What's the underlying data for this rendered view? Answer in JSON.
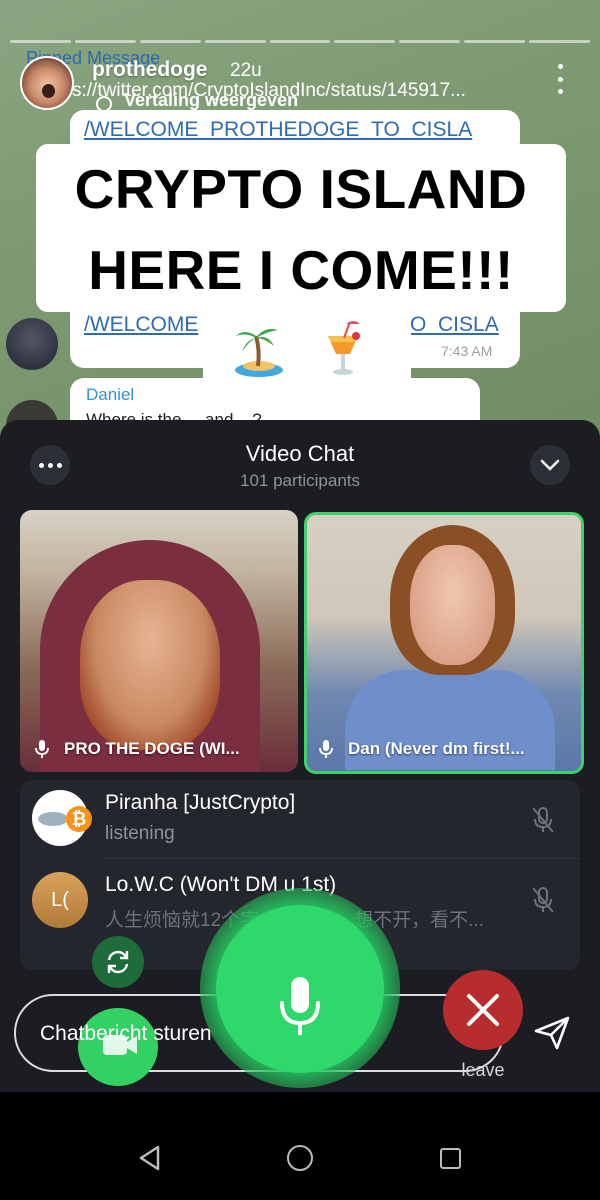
{
  "story": {
    "username": "prothedoge",
    "time_ago": "22u",
    "link_text": "s://twitter.com/CryptoIslandInc/status/145917...",
    "translate_label": "Vertaling weergeven"
  },
  "telegram_background": {
    "pinned_label": "Pinned Message",
    "message_link_1": "/WELCOME_PROTHEDOGE_TO_CISLA",
    "message_link_2": "/WELCOME",
    "message_link_2_tail": "O_CISLA",
    "message_time": "7:43 AM",
    "sender_name": "Daniel",
    "sender_text": "Where is the ... and ...?"
  },
  "caption": {
    "line1": "CRYPTO ISLAND",
    "line2": "HERE I COME!!!",
    "emojis": [
      "island-emoji",
      "tropical-drink-emoji"
    ]
  },
  "video_chat": {
    "title": "Video Chat",
    "participants_count": "101 participants",
    "tiles": [
      {
        "label": "PRO THE DOGE (WI..."
      },
      {
        "label": "Dan (Never dm first!..."
      }
    ],
    "participants": [
      {
        "name": "Piranha [JustCrypto]",
        "status": "listening",
        "avatar_coin": "₿"
      },
      {
        "name": "Lo.W.C (Won't DM u 1st)",
        "status": "人生烦恼就12个字：放不下，想不开，看不...",
        "avatar_initials": "L("
      }
    ],
    "leave_label": "leave"
  },
  "message_input": {
    "placeholder": "Chatbericht sturen"
  },
  "colors": {
    "active_speaker_border": "#3ed36a",
    "mic_green": "#2fd86a",
    "leave_red": "#b72d2d",
    "panel_bg": "#1b1d22"
  }
}
